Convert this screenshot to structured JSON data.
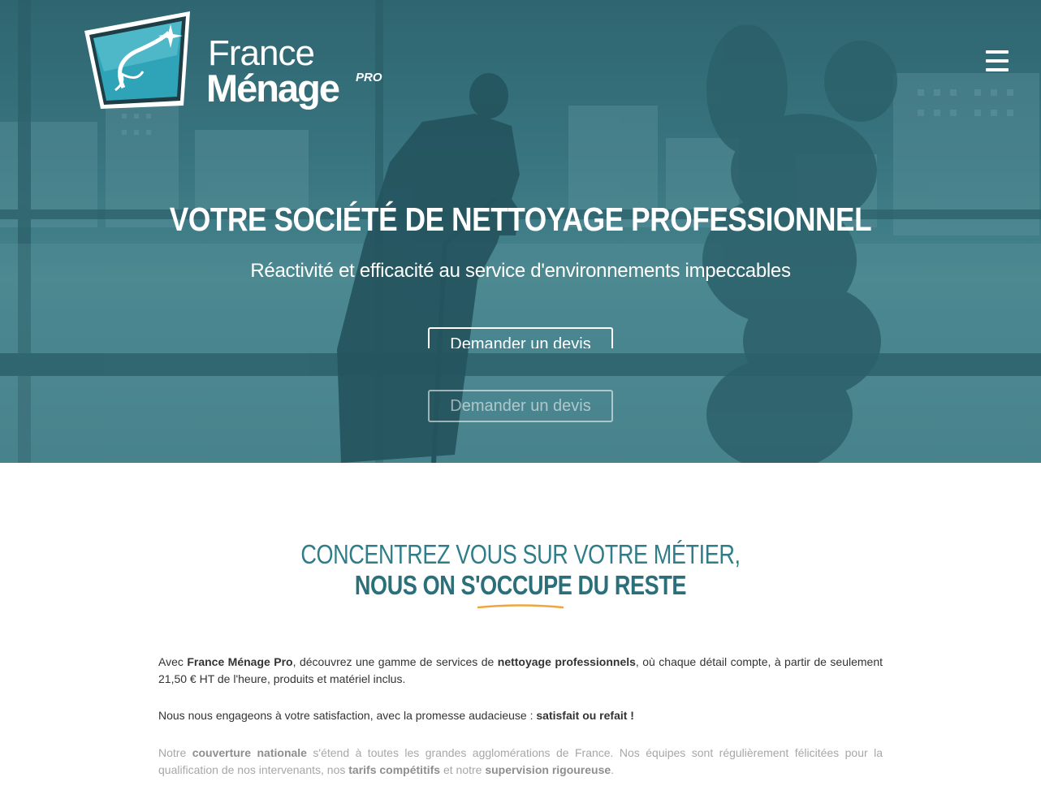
{
  "brand": {
    "line1": "France",
    "line2": "Ménage",
    "suffix": "PRO"
  },
  "nav": {
    "menu_icon": "hamburger-menu-icon"
  },
  "hero": {
    "title_light": "VOTRE ",
    "title_strong": "SOCIÉTÉ DE NETTOYAGE PROFESSIONNEL",
    "subtitle": "Réactivité et efficacité au service d'environnements impeccables",
    "cta_primary": "Demander un devis",
    "cta_secondary": "Demander un devis"
  },
  "section": {
    "heading_line1": "CONCENTREZ VOUS SUR VOTRE MÉTIER,",
    "heading_line2": "NOUS ON S'OCCUPE DU RESTE",
    "p1": {
      "t1": "Avec ",
      "b1": "France Ménage Pro",
      "t2": ", découvrez une gamme de services de ",
      "b2": "nettoyage professionnels",
      "t3": ", où chaque détail compte, à partir de seulement 21,50 € HT de l'heure, produits et matériel inclus."
    },
    "p2": {
      "t1": "Nous nous engageons à votre satisfaction, avec la promesse audacieuse : ",
      "b1": "satisfait ou refait !"
    },
    "p3": {
      "t1": "Notre ",
      "b1": "couverture nationale",
      "t2": " s'étend à toutes les grandes agglomérations de France. Nos équipes sont régulièrement félicitées pour la qualification de nos intervenants, nos ",
      "b2": "tarifs compétitifs",
      "t3": " et notre ",
      "b3": "supervision rigoureuse",
      "t4": "."
    }
  },
  "colors": {
    "hero_overlay": "#3c7883",
    "heading_teal": "#2f7d89",
    "underline_orange": "#f0a640"
  }
}
